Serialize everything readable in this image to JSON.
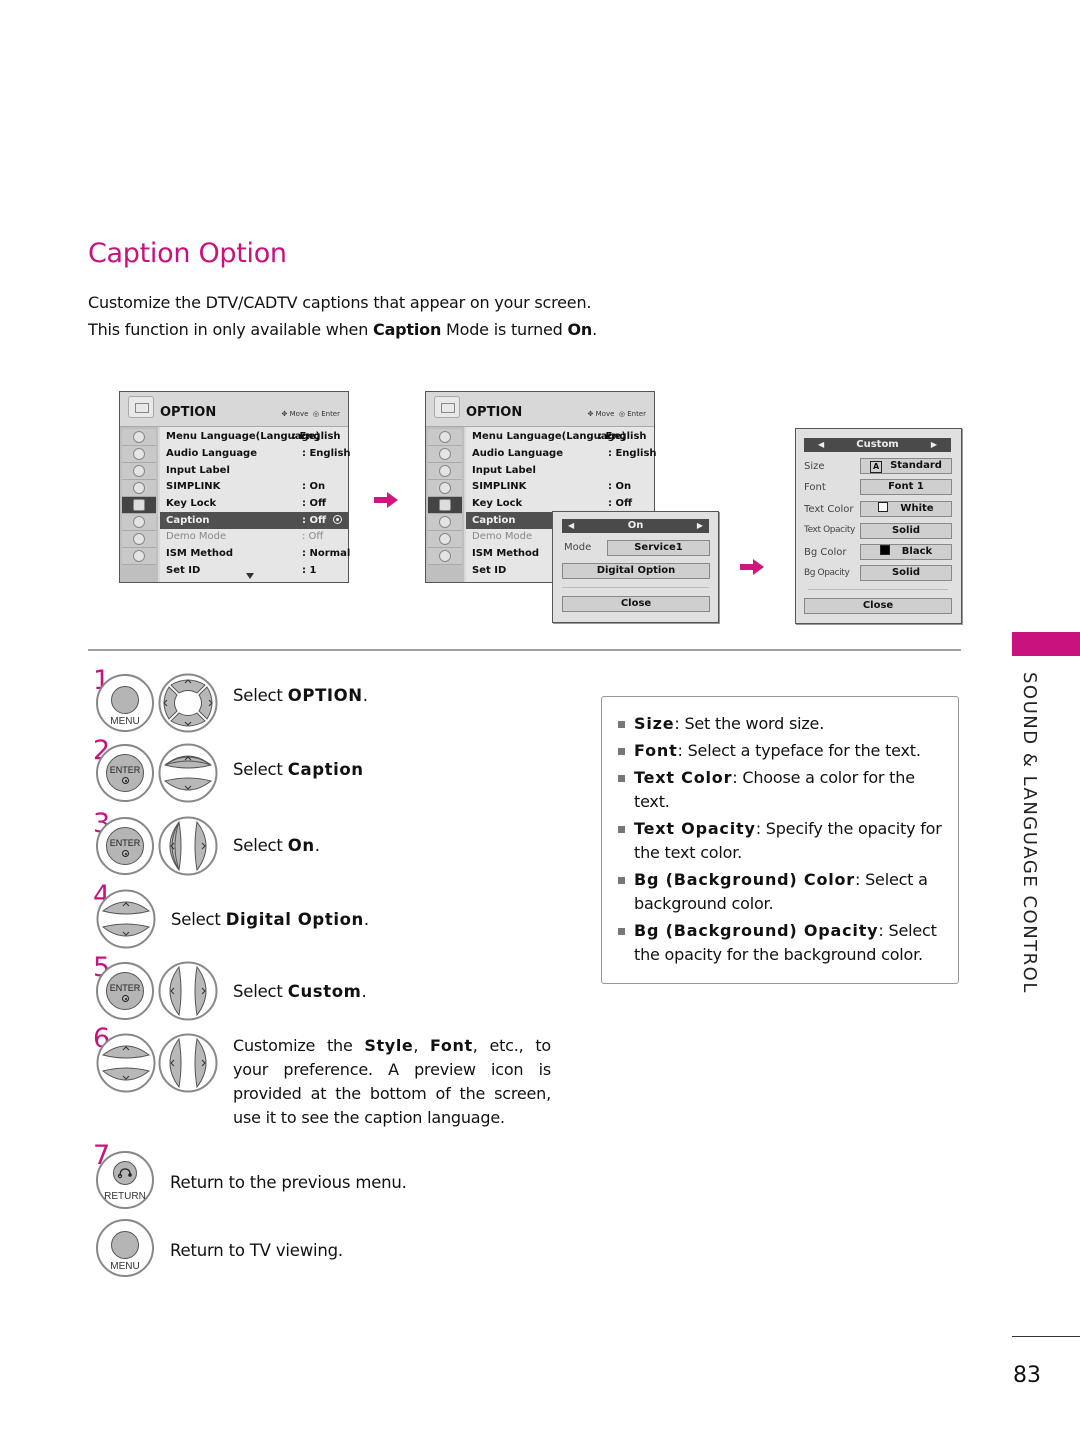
{
  "page": {
    "title": "Caption Option",
    "intro_line1": "Customize the DTV/CADTV captions that appear on your screen.",
    "intro_line2_parts": [
      "This function in only available when ",
      "Caption",
      " Mode is turned ",
      "On",
      "."
    ],
    "side_section_title": "SOUND & LANGUAGE CONTROL",
    "page_number": "83",
    "accent_color": "#c8127e"
  },
  "osd_menu_1": {
    "header": "OPTION",
    "hint_move": "Move",
    "hint_enter": "Enter",
    "rows": [
      {
        "label": "Menu Language(Language)",
        "value": ": English"
      },
      {
        "label": "Audio Language",
        "value": ": English"
      },
      {
        "label": "Input Label",
        "value": ""
      },
      {
        "label": "SIMPLINK",
        "value": ": On"
      },
      {
        "label": "Key Lock",
        "value": ": Off"
      },
      {
        "label": "Caption",
        "value": ": Off",
        "selected": true
      },
      {
        "label": "Demo Mode",
        "value": ": Off",
        "disabled": true
      },
      {
        "label": "ISM Method",
        "value": ": Normal"
      },
      {
        "label": "Set ID",
        "value": ": 1"
      }
    ]
  },
  "osd_menu_2": {
    "header": "OPTION",
    "hint_move": "Move",
    "hint_enter": "Enter",
    "rows": [
      {
        "label": "Menu Language(Language)",
        "value": ": English"
      },
      {
        "label": "Audio Language",
        "value": ": English"
      },
      {
        "label": "Input Label",
        "value": ""
      },
      {
        "label": "SIMPLINK",
        "value": ": On"
      },
      {
        "label": "Key Lock",
        "value": ": Off"
      },
      {
        "label": "Caption",
        "value": "",
        "selected": true
      },
      {
        "label": "Demo Mode",
        "value": "",
        "disabled": true
      },
      {
        "label": "ISM Method",
        "value": ""
      },
      {
        "label": "Set ID",
        "value": ""
      }
    ],
    "popup": {
      "selector_value": "On",
      "mode_label": "Mode",
      "mode_value": "Service1",
      "digital_option_label": "Digital Option",
      "close_label": "Close"
    }
  },
  "custom_panel": {
    "selector_value": "Custom",
    "rows": [
      {
        "label": "Size",
        "value": "Standard",
        "icon": "letter-a-icon"
      },
      {
        "label": "Font",
        "value": "Font 1"
      },
      {
        "label": "Text Color",
        "value": "White",
        "swatch": "#ffffff"
      },
      {
        "label": "Text Opacity",
        "value": "Solid"
      },
      {
        "label": "Bg Color",
        "value": "Black",
        "swatch": "#000000"
      },
      {
        "label": "Bg Opacity",
        "value": "Solid"
      }
    ],
    "close_label": "Close"
  },
  "steps": [
    {
      "number": "1",
      "buttons": [
        "MENU",
        "nav-4way"
      ],
      "text_plain": "Select ",
      "text_bold": "OPTION",
      "text_end": "."
    },
    {
      "number": "2",
      "buttons": [
        "ENTER",
        "nav-updown"
      ],
      "text_plain": "Select ",
      "text_bold": "Caption",
      "text_end": ""
    },
    {
      "number": "3",
      "buttons": [
        "ENTER",
        "nav-leftright"
      ],
      "text_plain": "Select ",
      "text_bold": "On",
      "text_end": "."
    },
    {
      "number": "4",
      "buttons": [
        "nav-updown"
      ],
      "text_plain": "Select ",
      "text_bold": "Digital Option",
      "text_end": "."
    },
    {
      "number": "5",
      "buttons": [
        "ENTER",
        "nav-leftright"
      ],
      "text_plain": "Select ",
      "text_bold": "Custom",
      "text_end": "."
    },
    {
      "number": "6",
      "buttons": [
        "nav-updown",
        "nav-leftright"
      ],
      "text_parts": [
        "Customize the ",
        "Style",
        ", ",
        "Font",
        ", etc., to your preference. A preview icon is provided at the bottom of the screen, use it to see the caption language."
      ]
    },
    {
      "number": "7",
      "buttons": [
        "RETURN"
      ],
      "text": "Return to the previous menu."
    },
    {
      "number": "",
      "buttons": [
        "MENU"
      ],
      "text": "Return to TV viewing."
    }
  ],
  "button_labels": {
    "menu": "MENU",
    "enter": "ENTER",
    "return": "RETURN"
  },
  "info_box": {
    "items": [
      {
        "term": "Size",
        "desc": ": Set the word size."
      },
      {
        "term": "Font",
        "desc": ": Select a typeface for the text."
      },
      {
        "term": "Text Color",
        "desc": ": Choose a color for the text."
      },
      {
        "term": "Text Opacity",
        "desc": ": Specify the opacity for the text color."
      },
      {
        "term": "Bg (Background) Color",
        "desc": ": Select a background color."
      },
      {
        "term": "Bg (Background) Opacity",
        "desc": ": Select the opacity for the background color."
      }
    ]
  }
}
